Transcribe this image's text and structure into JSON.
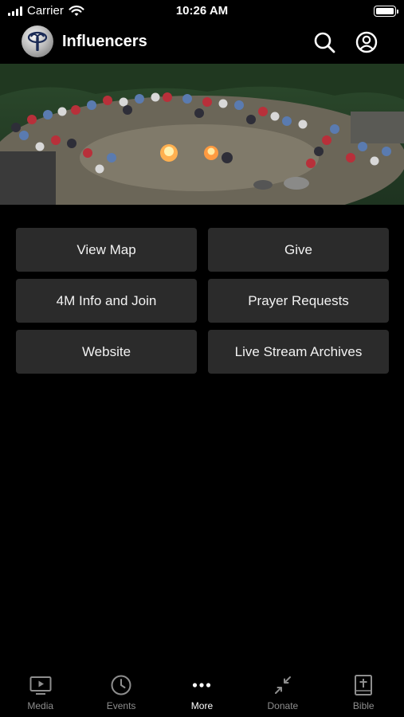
{
  "status_bar": {
    "carrier": "Carrier",
    "time": "10:26 AM"
  },
  "header": {
    "title": "Influencers",
    "logo_icon": "influencers-logo",
    "search_icon": "search-icon",
    "account_icon": "account-icon"
  },
  "hero": {
    "description_icon": "campfire-gathering-photo"
  },
  "tiles": [
    {
      "label": "View Map"
    },
    {
      "label": "Give"
    },
    {
      "label": "4M Info and Join"
    },
    {
      "label": "Prayer Requests"
    },
    {
      "label": "Website"
    },
    {
      "label": "Live Stream Archives"
    }
  ],
  "tabs": [
    {
      "label": "Media",
      "icon": "media-icon"
    },
    {
      "label": "Events",
      "icon": "clock-icon"
    },
    {
      "label": "More",
      "icon": "more-icon",
      "active": true
    },
    {
      "label": "Donate",
      "icon": "donate-icon"
    },
    {
      "label": "Bible",
      "icon": "bible-icon"
    }
  ],
  "colors": {
    "background": "#000000",
    "tile": "#2b2b2b",
    "tab_inactive": "#8e8e8e",
    "tab_active": "#ffffff"
  }
}
